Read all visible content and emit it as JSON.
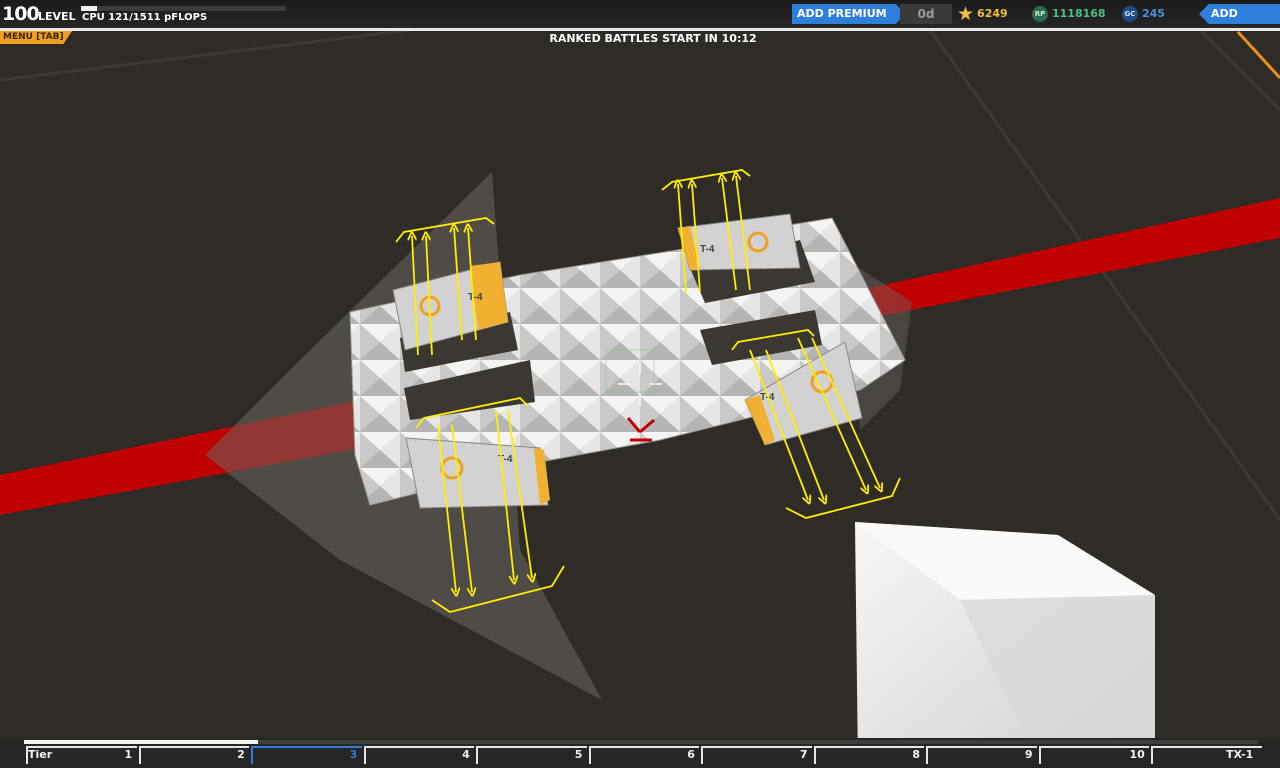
{
  "hud": {
    "level_value": "100",
    "level_label": "LEVEL",
    "cpu_label": "CPU 121/1511 pFLOPS",
    "cpu_fraction": 0.08,
    "premium_button": "ADD PREMIUM",
    "premium_days": "0d",
    "currency_star": "6249",
    "currency_rp": "1118168",
    "currency_rp_icon": "RP",
    "currency_gc": "245",
    "currency_gc_icon": "GC",
    "funds_button": "ADD FUNDS",
    "menu_label": "MENU [TAB]",
    "ranked_notice": "RANKED BATTLES START IN 10:12"
  },
  "thrusters": [
    {
      "label": "T-4"
    },
    {
      "label": "T-4"
    },
    {
      "label": "T-4"
    },
    {
      "label": "T-4"
    }
  ],
  "tiers": {
    "title": "Tier",
    "progress_fraction": 0.19,
    "active_index": 2,
    "labels": [
      "1",
      "2",
      "3",
      "4",
      "5",
      "6",
      "7",
      "8",
      "9",
      "10",
      "TX-1"
    ]
  },
  "colors": {
    "accent_blue": "#2e7fdc",
    "menu_orange": "#f0a020",
    "star_gold": "#f0c040",
    "rp_green": "#4dbf86",
    "gc_blue": "#4d8fe0",
    "beam_red": "#c00000",
    "arrow_yellow": "#ffee00"
  }
}
